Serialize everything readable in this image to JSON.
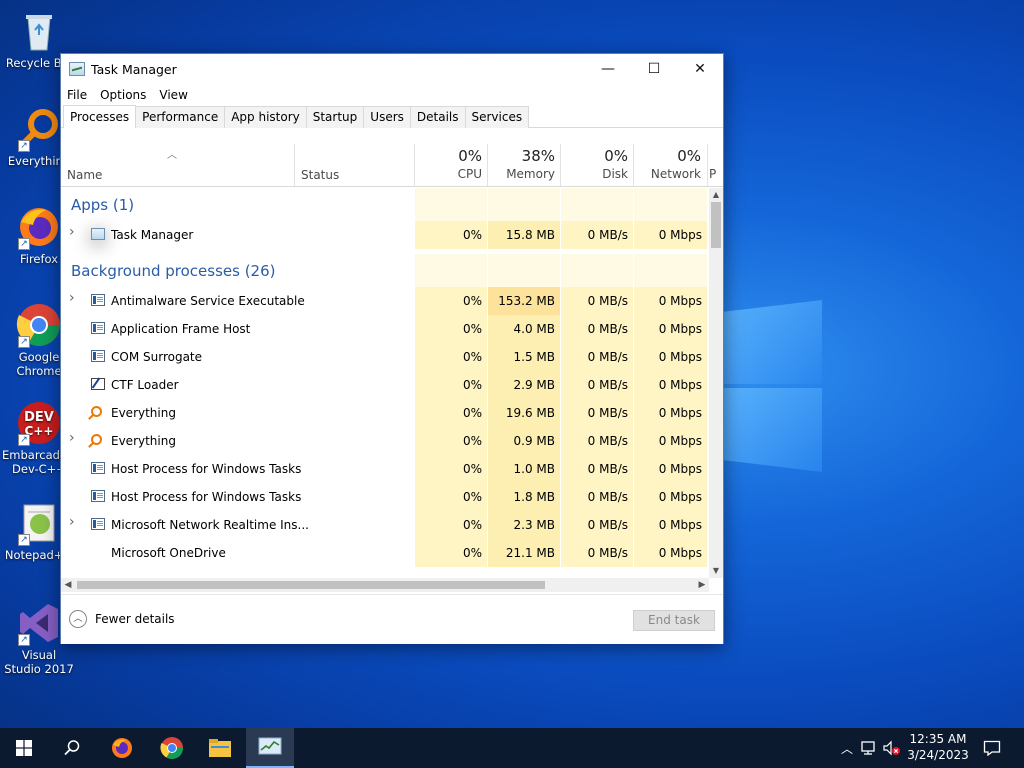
{
  "desktop": {
    "icons": [
      {
        "label": "Recycle Bin",
        "icon": "recycle-bin-icon"
      },
      {
        "label": "Everything",
        "icon": "everything-icon"
      },
      {
        "label": "Firefox",
        "icon": "firefox-icon"
      },
      {
        "label": "Google Chrome",
        "icon": "chrome-icon"
      },
      {
        "label": "Embarcadero Dev-C++",
        "icon": "devcpp-icon"
      },
      {
        "label": "Notepad++",
        "icon": "notepadpp-icon"
      },
      {
        "label": "Visual Studio 2017",
        "icon": "visual-studio-icon"
      }
    ]
  },
  "window": {
    "title": "Task Manager",
    "minimize": "—",
    "maximize": "☐",
    "close": "✕"
  },
  "menu": [
    "File",
    "Options",
    "View"
  ],
  "tabs": [
    "Processes",
    "Performance",
    "App history",
    "Startup",
    "Users",
    "Details",
    "Services"
  ],
  "columns": {
    "name": "Name",
    "status": "Status",
    "cpu": {
      "pct": "0%",
      "label": "CPU"
    },
    "memory": {
      "pct": "38%",
      "label": "Memory"
    },
    "disk": {
      "pct": "0%",
      "label": "Disk"
    },
    "network": {
      "pct": "0%",
      "label": "Network"
    },
    "power": "P"
  },
  "groups": {
    "apps": "Apps (1)",
    "background": "Background processes (26)"
  },
  "apps": [
    {
      "name": "Task Manager",
      "cpu": "0%",
      "memory": "15.8 MB",
      "disk": "0 MB/s",
      "network": "0 Mbps",
      "expand": true,
      "icon": "tm"
    }
  ],
  "background": [
    {
      "name": "Antimalware Service Executable",
      "cpu": "0%",
      "memory": "153.2 MB",
      "disk": "0 MB/s",
      "network": "0 Mbps",
      "expand": true,
      "icon": "sys"
    },
    {
      "name": "Application Frame Host",
      "cpu": "0%",
      "memory": "4.0 MB",
      "disk": "0 MB/s",
      "network": "0 Mbps",
      "expand": false,
      "icon": "sys"
    },
    {
      "name": "COM Surrogate",
      "cpu": "0%",
      "memory": "1.5 MB",
      "disk": "0 MB/s",
      "network": "0 Mbps",
      "expand": false,
      "icon": "sys"
    },
    {
      "name": "CTF Loader",
      "cpu": "0%",
      "memory": "2.9 MB",
      "disk": "0 MB/s",
      "network": "0 Mbps",
      "expand": false,
      "icon": "ctf"
    },
    {
      "name": "Everything",
      "cpu": "0%",
      "memory": "19.6 MB",
      "disk": "0 MB/s",
      "network": "0 Mbps",
      "expand": false,
      "icon": "ever"
    },
    {
      "name": "Everything",
      "cpu": "0%",
      "memory": "0.9 MB",
      "disk": "0 MB/s",
      "network": "0 Mbps",
      "expand": true,
      "icon": "ever"
    },
    {
      "name": "Host Process for Windows Tasks",
      "cpu": "0%",
      "memory": "1.0 MB",
      "disk": "0 MB/s",
      "network": "0 Mbps",
      "expand": false,
      "icon": "sys"
    },
    {
      "name": "Host Process for Windows Tasks",
      "cpu": "0%",
      "memory": "1.8 MB",
      "disk": "0 MB/s",
      "network": "0 Mbps",
      "expand": false,
      "icon": "sys"
    },
    {
      "name": "Microsoft Network Realtime Ins...",
      "cpu": "0%",
      "memory": "2.3 MB",
      "disk": "0 MB/s",
      "network": "0 Mbps",
      "expand": true,
      "icon": "sys"
    },
    {
      "name": "Microsoft OneDrive",
      "cpu": "0%",
      "memory": "21.1 MB",
      "disk": "0 MB/s",
      "network": "0 Mbps",
      "expand": false,
      "icon": "none"
    }
  ],
  "footer": {
    "fewer_details": "Fewer details",
    "end_task": "End task"
  },
  "taskbar": {
    "items": [
      "start-icon",
      "search-icon",
      "firefox-icon",
      "chrome-icon",
      "file-explorer-icon",
      "task-manager-icon"
    ],
    "time": "12:35 AM",
    "date": "3/24/2023"
  }
}
